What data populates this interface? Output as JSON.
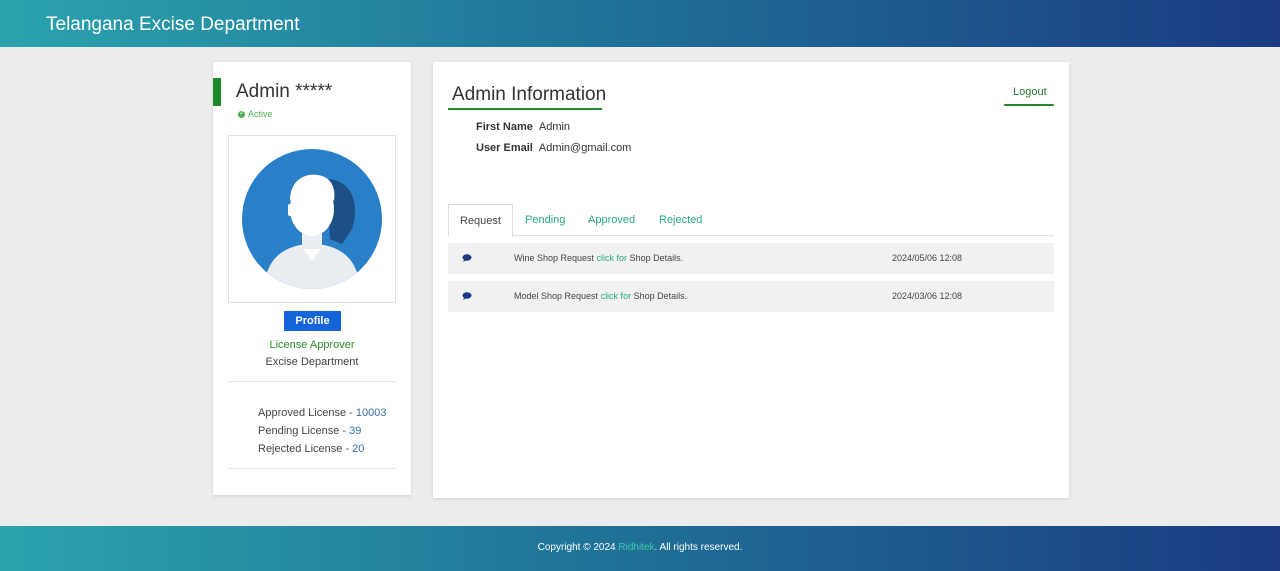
{
  "header": {
    "brand": "Telangana Excise Department"
  },
  "profile_card": {
    "name": "Admin *****",
    "status": "Active",
    "profile_button": "Profile",
    "role": "License Approver",
    "department": "Excise Department",
    "stats": [
      {
        "label": "Approved License - ",
        "value": "10003"
      },
      {
        "label": "Pending License - ",
        "value": "39"
      },
      {
        "label": "Rejected License - ",
        "value": "20"
      }
    ]
  },
  "main": {
    "title": "Admin Information",
    "logout_label": "Logout",
    "first_name_label": "First Name",
    "first_name_value": "Admin",
    "email_label": "User Email",
    "email_value": "Admin@gmail.com",
    "tabs": [
      "Request",
      "Pending",
      "Approved",
      "Rejected"
    ],
    "requests": [
      {
        "prefix": "Wine Shop Request ",
        "link": "click for",
        "suffix": " Shop Details.",
        "date": "2024/05/06 12:08"
      },
      {
        "prefix": "Model Shop Request ",
        "link": "click for",
        "suffix": " Shop Details.",
        "date": "2024/03/06 12:08"
      }
    ]
  },
  "footer": {
    "prefix": "Copyright © 2024 ",
    "brand": "Ridhitek",
    "suffix": ". All rights reserved."
  },
  "colors": {
    "accent_green": "#1d8a2a",
    "primary_blue": "#1565d8",
    "link_teal": "#2aa882"
  }
}
